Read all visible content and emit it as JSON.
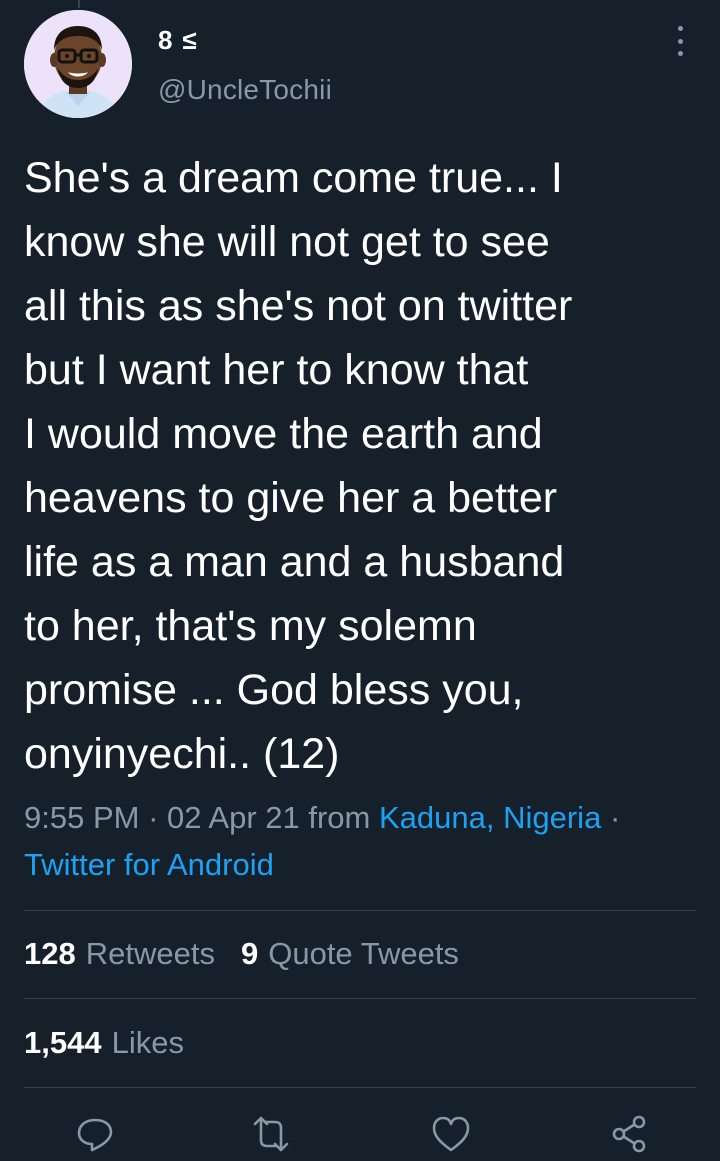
{
  "profile": {
    "name_glyphs": [
      "8",
      "≤"
    ],
    "handle": "@UncleTochii",
    "avatar_icon": "bitmoji-avatar"
  },
  "tweet": {
    "text": "She's a dream come true... I\nknow she will not get to see\nall this as she's not on twitter\nbut I want her to know that\nI would move the earth and\nheavens to give her a better\nlife as a man and a husband\nto her, that's my solemn\npromise ... God bless you,\nonyinyechi.. (12)",
    "time": "9:55 PM",
    "date": "02 Apr 21",
    "from_label": "from",
    "location": "Kaduna, Nigeria",
    "source": "Twitter for Android",
    "separator": "·"
  },
  "stats": {
    "retweets_count": "128",
    "retweets_label": "Retweets",
    "quotes_count": "9",
    "quotes_label": "Quote Tweets",
    "likes_count": "1,544",
    "likes_label": "Likes"
  },
  "actions": {
    "reply_icon": "reply-icon",
    "retweet_icon": "retweet-icon",
    "like_icon": "like-icon",
    "share_icon": "share-icon"
  },
  "colors": {
    "background": "#15202b",
    "text": "#ffffff",
    "secondary": "#8899a6",
    "link": "#1da1f2",
    "divider": "#38444d"
  }
}
